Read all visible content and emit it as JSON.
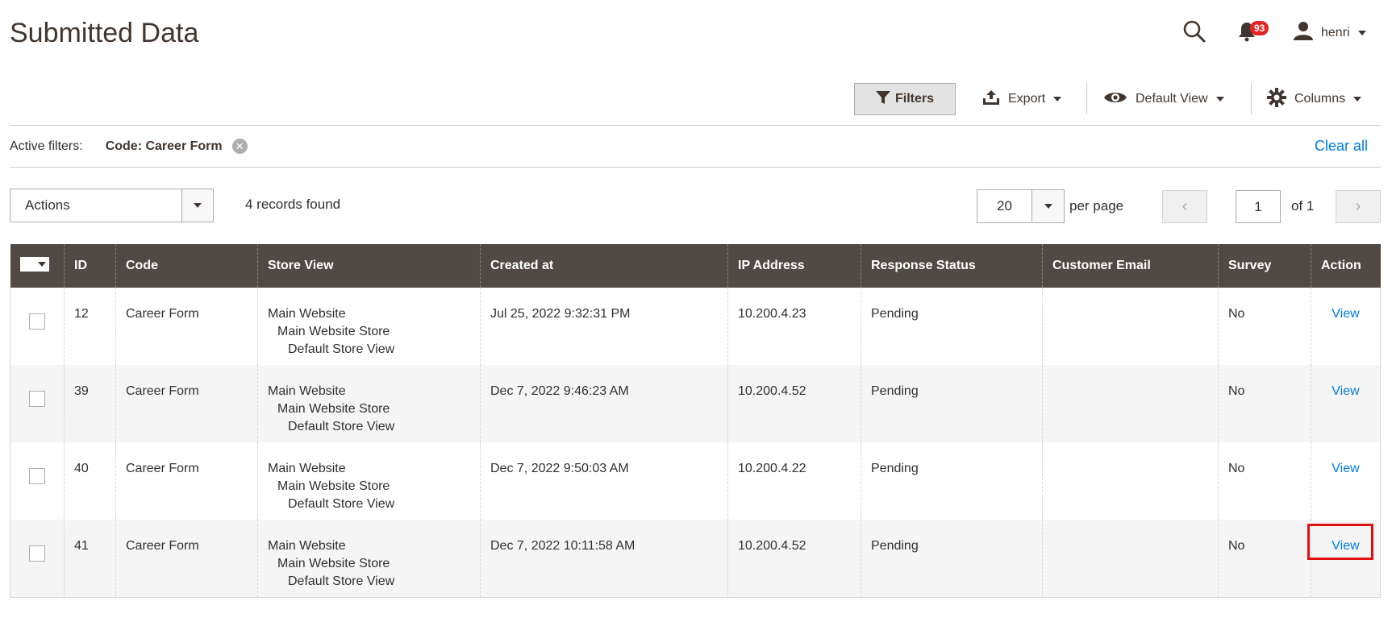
{
  "page": {
    "title": "Submitted Data"
  },
  "header": {
    "notification_count": "93",
    "user_name": "henri"
  },
  "toolbar": {
    "filters_label": "Filters",
    "export_label": "Export",
    "view_label": "Default View",
    "columns_label": "Columns"
  },
  "active_filters": {
    "label": "Active filters:",
    "chip": "Code: Career Form",
    "clear_all": "Clear all"
  },
  "grid_controls": {
    "actions_label": "Actions",
    "records_found": "4 records found",
    "per_page_value": "20",
    "per_page_label": "per page",
    "current_page": "1",
    "of_pages": "of 1"
  },
  "columns": [
    "ID",
    "Code",
    "Store View",
    "Created at",
    "IP Address",
    "Response Status",
    "Customer Email",
    "Survey",
    "Action"
  ],
  "rows": [
    {
      "id": "12",
      "code": "Career Form",
      "store_view": [
        "Main Website",
        "Main Website Store",
        "Default Store View"
      ],
      "created_at": "Jul 25, 2022 9:32:31 PM",
      "ip": "10.200.4.23",
      "status": "Pending",
      "email": "",
      "survey": "No",
      "action": "View"
    },
    {
      "id": "39",
      "code": "Career Form",
      "store_view": [
        "Main Website",
        "Main Website Store",
        "Default Store View"
      ],
      "created_at": "Dec 7, 2022 9:46:23 AM",
      "ip": "10.200.4.52",
      "status": "Pending",
      "email": "",
      "survey": "No",
      "action": "View"
    },
    {
      "id": "40",
      "code": "Career Form",
      "store_view": [
        "Main Website",
        "Main Website Store",
        "Default Store View"
      ],
      "created_at": "Dec 7, 2022 9:50:03 AM",
      "ip": "10.200.4.22",
      "status": "Pending",
      "email": "",
      "survey": "No",
      "action": "View"
    },
    {
      "id": "41",
      "code": "Career Form",
      "store_view": [
        "Main Website",
        "Main Website Store",
        "Default Store View"
      ],
      "created_at": "Dec 7, 2022 10:11:58 AM",
      "ip": "10.200.4.52",
      "status": "Pending",
      "email": "",
      "survey": "No",
      "action": "View"
    }
  ],
  "colors": {
    "header_bg": "#514943",
    "link": "#007bdb",
    "highlight": "#e01010",
    "badge": "#e22626"
  },
  "icons": [
    "search-icon",
    "bell-icon",
    "user-icon",
    "filter-icon",
    "export-icon",
    "eye-icon",
    "gear-icon",
    "close-icon",
    "chevron-left-icon",
    "chevron-right-icon"
  ]
}
